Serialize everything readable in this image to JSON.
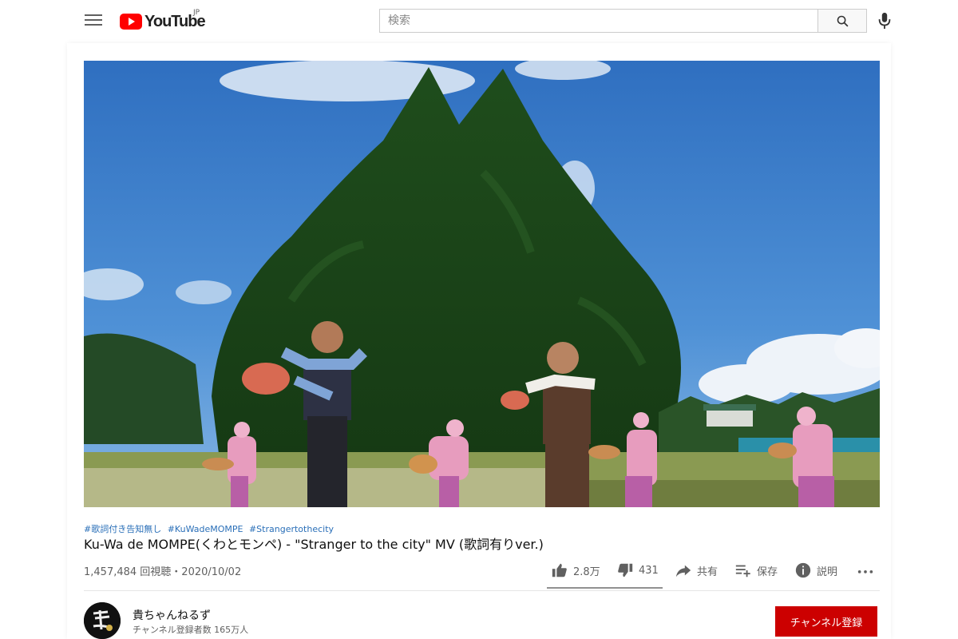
{
  "header": {
    "logo_text": "YouTube",
    "region": "JP",
    "search_placeholder": "検索",
    "icons": [
      "menu-icon",
      "youtube-logo-icon",
      "search-icon",
      "mic-icon"
    ]
  },
  "video": {
    "hashtags": [
      "#歌詞付き告知無し",
      "#KuWadeMOMPE",
      "#Strangertothecity"
    ],
    "title": "Ku-Wa de MOMPE(くわとモンペ) - \"Stranger to the city\" MV (歌詞有りver.)",
    "views_date": "1,457,484 回視聴・2020/10/02"
  },
  "actions": {
    "like": "2.8万",
    "dislike": "431",
    "share": "共有",
    "save": "保存",
    "description": "説明",
    "icons": [
      "thumb-up-icon",
      "thumb-down-icon",
      "share-icon",
      "playlist-add-icon",
      "info-icon",
      "more-icon"
    ]
  },
  "channel": {
    "name": "貴ちゃんねるず",
    "subscribers": "チャンネル登録者数 165万人",
    "subscribe_label": "チャンネル登録"
  },
  "colors": {
    "brand_red": "#ff0000",
    "subscribe_red": "#cc0000",
    "hashtag_blue": "#2a6fb8",
    "sky": "#3f7fc8"
  }
}
